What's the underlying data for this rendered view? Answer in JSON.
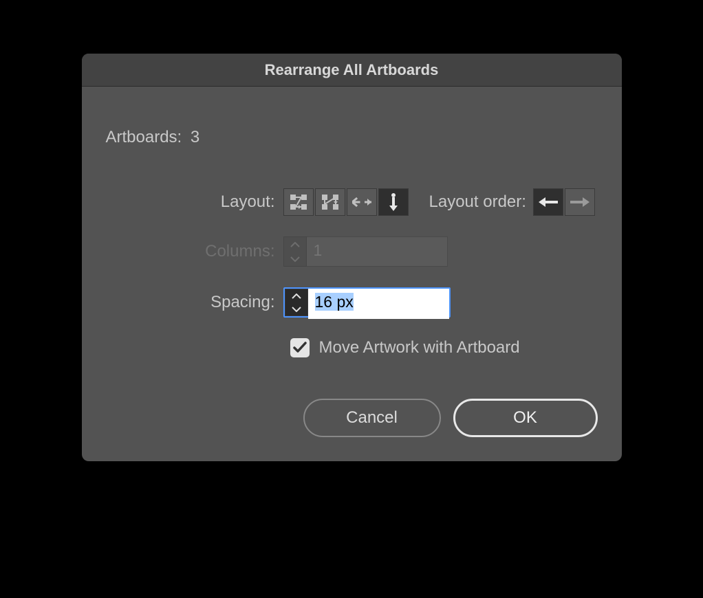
{
  "dialog": {
    "title": "Rearrange All Artboards",
    "artboards_label": "Artboards:",
    "artboards_count": "3",
    "layout_label": "Layout:",
    "layout_options": {
      "grid_row": "grid-by-row",
      "grid_col": "grid-by-column",
      "row": "arrange-by-row",
      "col": "arrange-by-column"
    },
    "layout_selected": "col",
    "layout_order_label": "Layout order:",
    "layout_order": {
      "ltr": "left-to-right",
      "rtl": "right-to-left"
    },
    "layout_order_selected": "ltr",
    "columns_label": "Columns:",
    "columns_value": "1",
    "columns_enabled": false,
    "spacing_label": "Spacing:",
    "spacing_value": "16 px",
    "move_artwork_label": "Move Artwork with Artboard",
    "move_artwork_checked": true,
    "buttons": {
      "cancel": "Cancel",
      "ok": "OK"
    }
  }
}
